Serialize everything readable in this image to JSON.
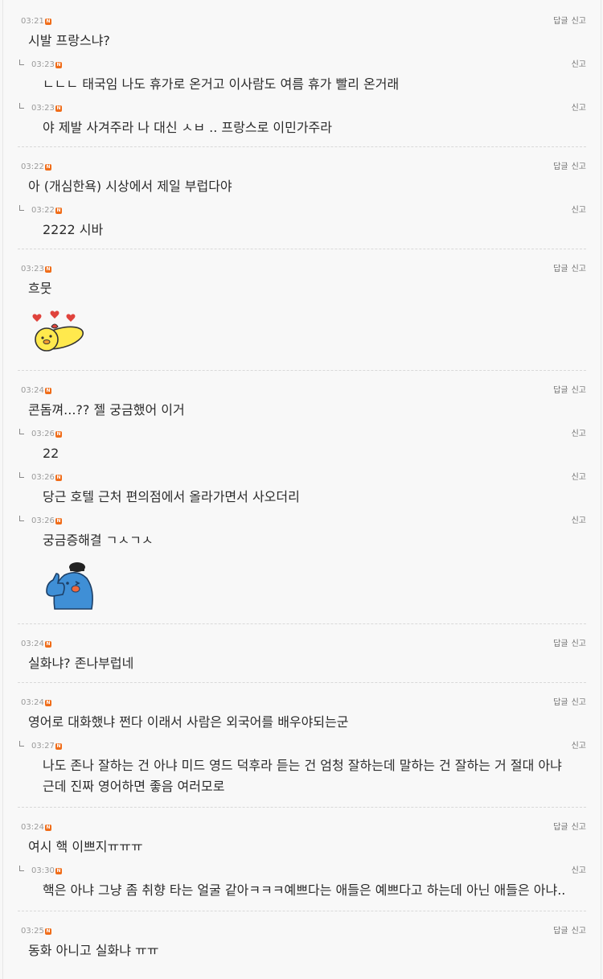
{
  "labels": {
    "reply": "답글",
    "report": "신고"
  },
  "badge": "N",
  "colors": {
    "new_badge": "#f06d1a",
    "text": "#2b2b2b",
    "meta": "#9a9a9a"
  },
  "threads": [
    {
      "time": "03:21",
      "text": "시발 프랑스냐?",
      "replies": [
        {
          "time": "03:23",
          "text": "ㄴㄴㄴ 태국임 나도 휴가로 온거고 이사람도 여름 휴가 빨리 온거래"
        },
        {
          "time": "03:23",
          "text": "야 제발 사겨주라 나 대신 ㅅㅂ .. 프랑스로 이민가주라"
        }
      ]
    },
    {
      "time": "03:22",
      "text": "아 (개심한욕) 시상에서 제일 부럽다야",
      "replies": [
        {
          "time": "03:22",
          "text": "2222 시바"
        }
      ]
    },
    {
      "time": "03:23",
      "text": "흐뭇",
      "replies": []
    },
    {
      "time": "03:24",
      "text": "콘돔껴...?? 젤 궁금했어 이거",
      "replies": [
        {
          "time": "03:26",
          "text": "22"
        },
        {
          "time": "03:26",
          "text": "당근 호텔 근처 편의점에서 올라가면서 사오더리"
        },
        {
          "time": "03:26",
          "text": "궁금증해결 ㄱㅅㄱㅅ"
        }
      ]
    },
    {
      "time": "03:24",
      "text": "실화냐? 존나부럽네",
      "replies": []
    },
    {
      "time": "03:24",
      "text": "영어로 대화했냐 쩐다 이래서 사람은 외국어를 배우야되는군",
      "replies": [
        {
          "time": "03:27",
          "text": "나도 존나 잘하는 건 아냐 미드 영드 덕후라 듣는 건 엄청 잘하는데 말하는 건 잘하는 거 절대 아냐 근데 진짜 영어하면 좋음 여러모로"
        }
      ]
    },
    {
      "time": "03:24",
      "text": "여시 핵 이쁘지ㅠㅠㅠ",
      "replies": [
        {
          "time": "03:30",
          "text": "핵은 아냐 그냥 좀 취향 타는 얼굴 같아ㅋㅋㅋ예쁘다는 애들은 예쁘다고 하는데 아닌 애들은 아냐.."
        }
      ]
    },
    {
      "time": "03:25",
      "text": "동화 아니고 실화냐 ㅠㅠ",
      "replies": []
    }
  ]
}
